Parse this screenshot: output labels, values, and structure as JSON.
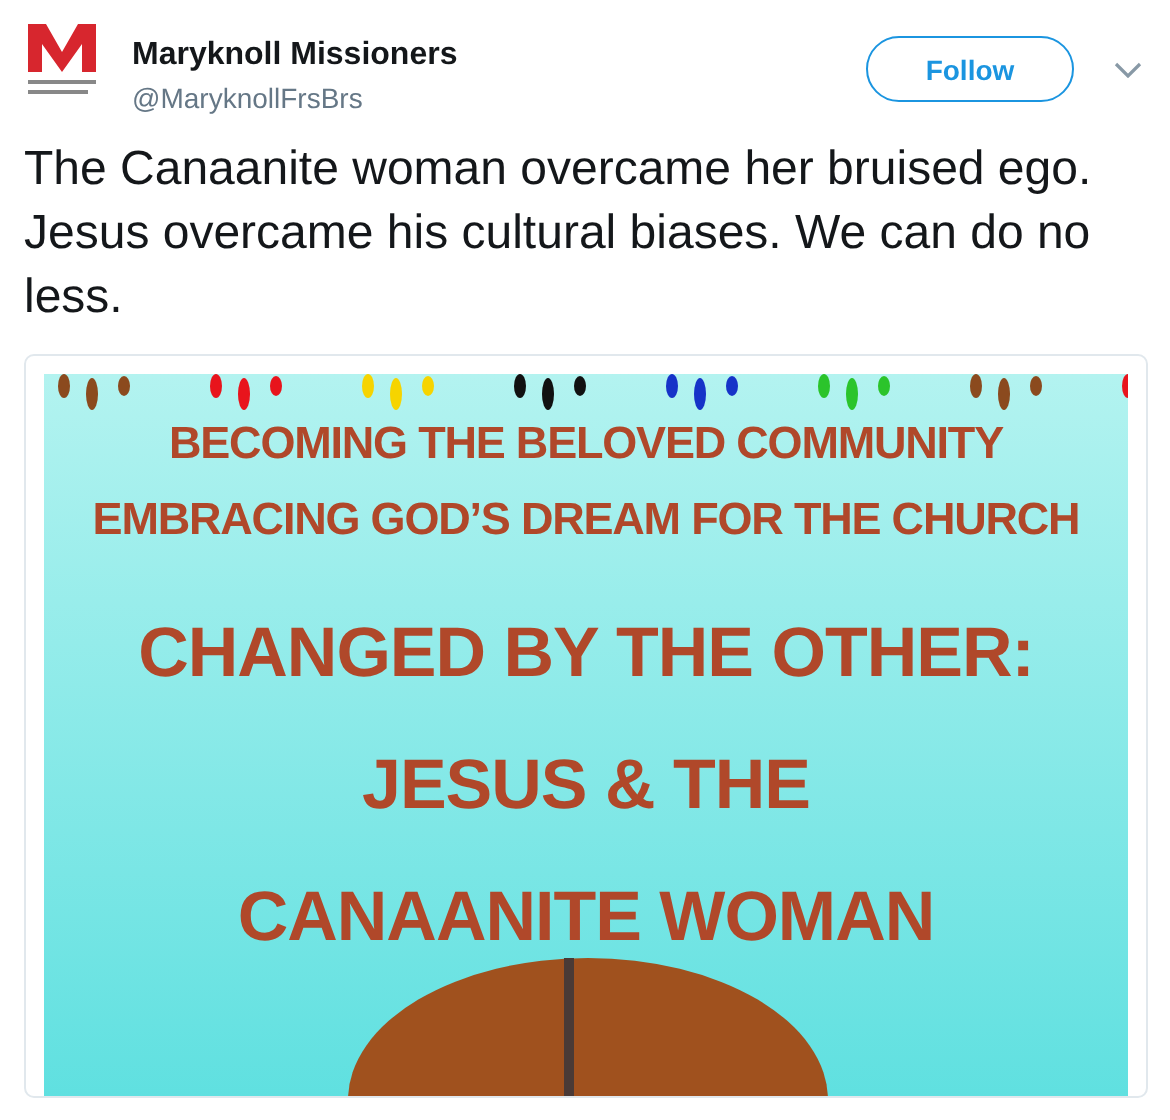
{
  "author": {
    "name": "Maryknoll Missioners",
    "handle": "@MaryknollFrsBrs"
  },
  "follow_button": {
    "label": "Follow"
  },
  "tweet_text": "The Canaanite woman overcame her bruised ego. Jesus overcame his cultural biases. We can do no less.",
  "media": {
    "lines": [
      {
        "text": "BECOMING THE BELOVED COMMUNITY",
        "kind": "subtitle"
      },
      {
        "text": "EMBRACING GOD’S DREAM FOR THE CHURCH",
        "kind": "subtitle"
      },
      {
        "text": "CHANGED BY THE OTHER:",
        "kind": "title"
      },
      {
        "text": "JESUS & THE",
        "kind": "title"
      },
      {
        "text": "CANAANITE WOMAN",
        "kind": "title"
      }
    ]
  }
}
